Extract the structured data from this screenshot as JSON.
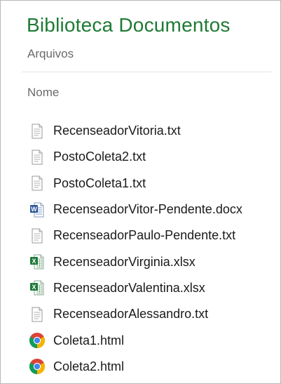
{
  "header": {
    "title": "Biblioteca Documentos",
    "subtitle": "Arquivos"
  },
  "columns": {
    "name": "Nome"
  },
  "colors": {
    "title": "#1e7b34",
    "muted": "#6a6a6a",
    "word_blue": "#2b5797",
    "excel_green": "#1f7a3a"
  },
  "files": [
    {
      "name": "RecenseadorVitoria.txt",
      "icon": "text-file-icon"
    },
    {
      "name": "PostoColeta2.txt",
      "icon": "text-file-icon"
    },
    {
      "name": "PostoColeta1.txt",
      "icon": "text-file-icon"
    },
    {
      "name": "RecenseadorVitor-Pendente.docx",
      "icon": "word-file-icon"
    },
    {
      "name": "RecenseadorPaulo-Pendente.txt",
      "icon": "text-file-icon"
    },
    {
      "name": "RecenseadorVirginia.xlsx",
      "icon": "excel-file-icon"
    },
    {
      "name": "RecenseadorValentina.xlsx",
      "icon": "excel-file-icon"
    },
    {
      "name": "RecenseadorAlessandro.txt",
      "icon": "text-file-icon"
    },
    {
      "name": "Coleta1.html",
      "icon": "chrome-html-icon"
    },
    {
      "name": "Coleta2.html",
      "icon": "chrome-html-icon"
    }
  ]
}
